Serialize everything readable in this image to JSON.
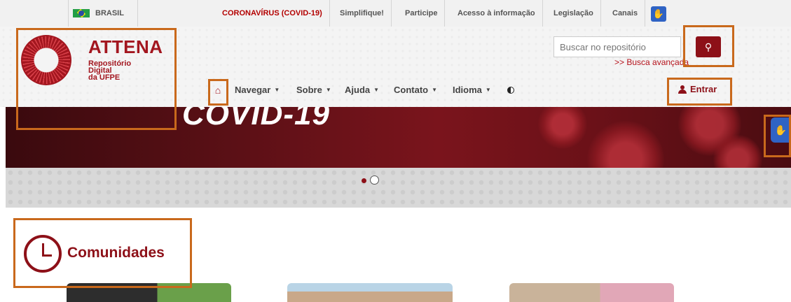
{
  "govbar": {
    "country": "BRASIL",
    "links": [
      "CORONAVÍRUS (COVID-19)",
      "Simplifique!",
      "Participe",
      "Acesso à informação",
      "Legislação",
      "Canais"
    ]
  },
  "header": {
    "logo_title": "ATTENA",
    "logo_sub": [
      "Repositório",
      "Digital",
      "da UFPE"
    ],
    "search_placeholder": "Buscar no repositório",
    "advanced_search": ">> Busca avançada",
    "nav": [
      "Navegar",
      "Sobre",
      "Ajuda",
      "Contato",
      "Idioma"
    ],
    "login": "Entrar"
  },
  "banner": {
    "text": "COVID-19"
  },
  "section": {
    "title": "Comunidades"
  }
}
